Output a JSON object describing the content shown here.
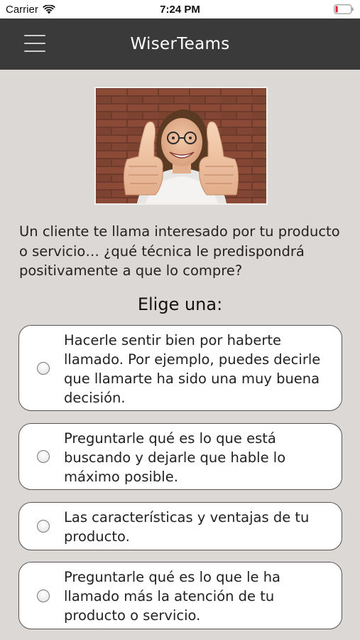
{
  "status_bar": {
    "carrier": "Carrier",
    "time": "7:24 PM",
    "battery_color": "#e0233a"
  },
  "header": {
    "title": "WiserTeams",
    "background": "#3a3a3a"
  },
  "hero_image": {
    "icon": "person-thumbs-up-photo"
  },
  "question": {
    "text": "Un cliente te llama interesado por tu producto o servicio… ¿qué técnica le predispondrá positivamente a que lo compre?"
  },
  "choose_label": "Elige una:",
  "options": [
    {
      "text": "Hacerle sentir bien por haberte llamado. Por ejemplo, puedes decirle que llamarte ha sido una muy buena decisión.",
      "selected": false
    },
    {
      "text": "Preguntarle qué es lo que está buscando y dejarle que hable lo máximo posible.",
      "selected": false
    },
    {
      "text": "Las características y ventajas de tu producto.",
      "selected": false
    },
    {
      "text": "Preguntarle qué es lo que le ha llamado más la atención de tu producto o servicio.",
      "selected": false
    }
  ]
}
